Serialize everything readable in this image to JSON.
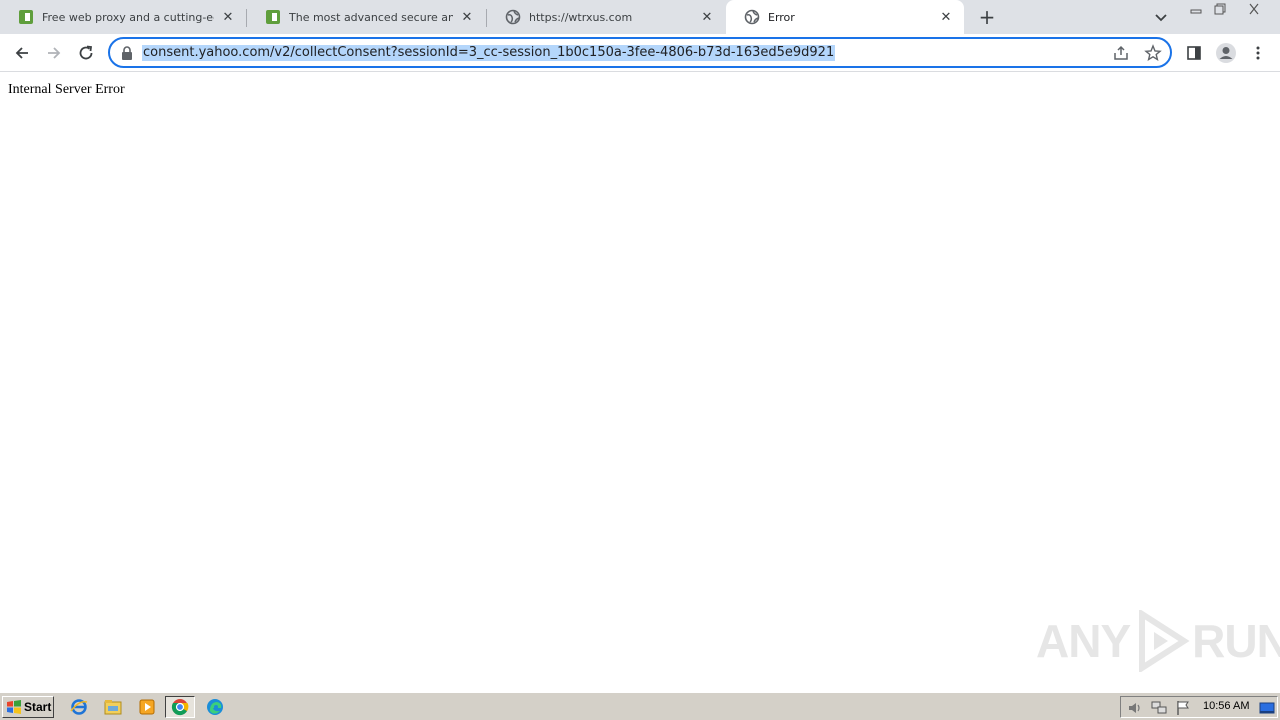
{
  "browser": {
    "tabs": [
      {
        "title": "Free web proxy and a cutting-edge o",
        "favicon": "croxy-icon",
        "active": false
      },
      {
        "title": "The most advanced secure and free",
        "favicon": "croxy-icon",
        "active": false
      },
      {
        "title": "https://wtrxus.com",
        "favicon": "globe-icon",
        "active": false
      },
      {
        "title": "Error",
        "favicon": "globe-icon",
        "active": true
      }
    ],
    "url": "consent.yahoo.com/v2/collectConsent?sessionId=3_cc-session_1b0c150a-3fee-4806-b73d-163ed5e9d921",
    "accent_color": "#1a73e8",
    "selection_color": "#b4d6fb"
  },
  "page": {
    "error_text": "Internal Server Error"
  },
  "watermark": {
    "left": "ANY",
    "right": "RUN"
  },
  "taskbar": {
    "start_label": "Start",
    "clock": "10:56 AM",
    "pinned": [
      "ie-icon",
      "explorer-icon",
      "media-player-icon",
      "chrome-icon",
      "edge-icon"
    ]
  }
}
